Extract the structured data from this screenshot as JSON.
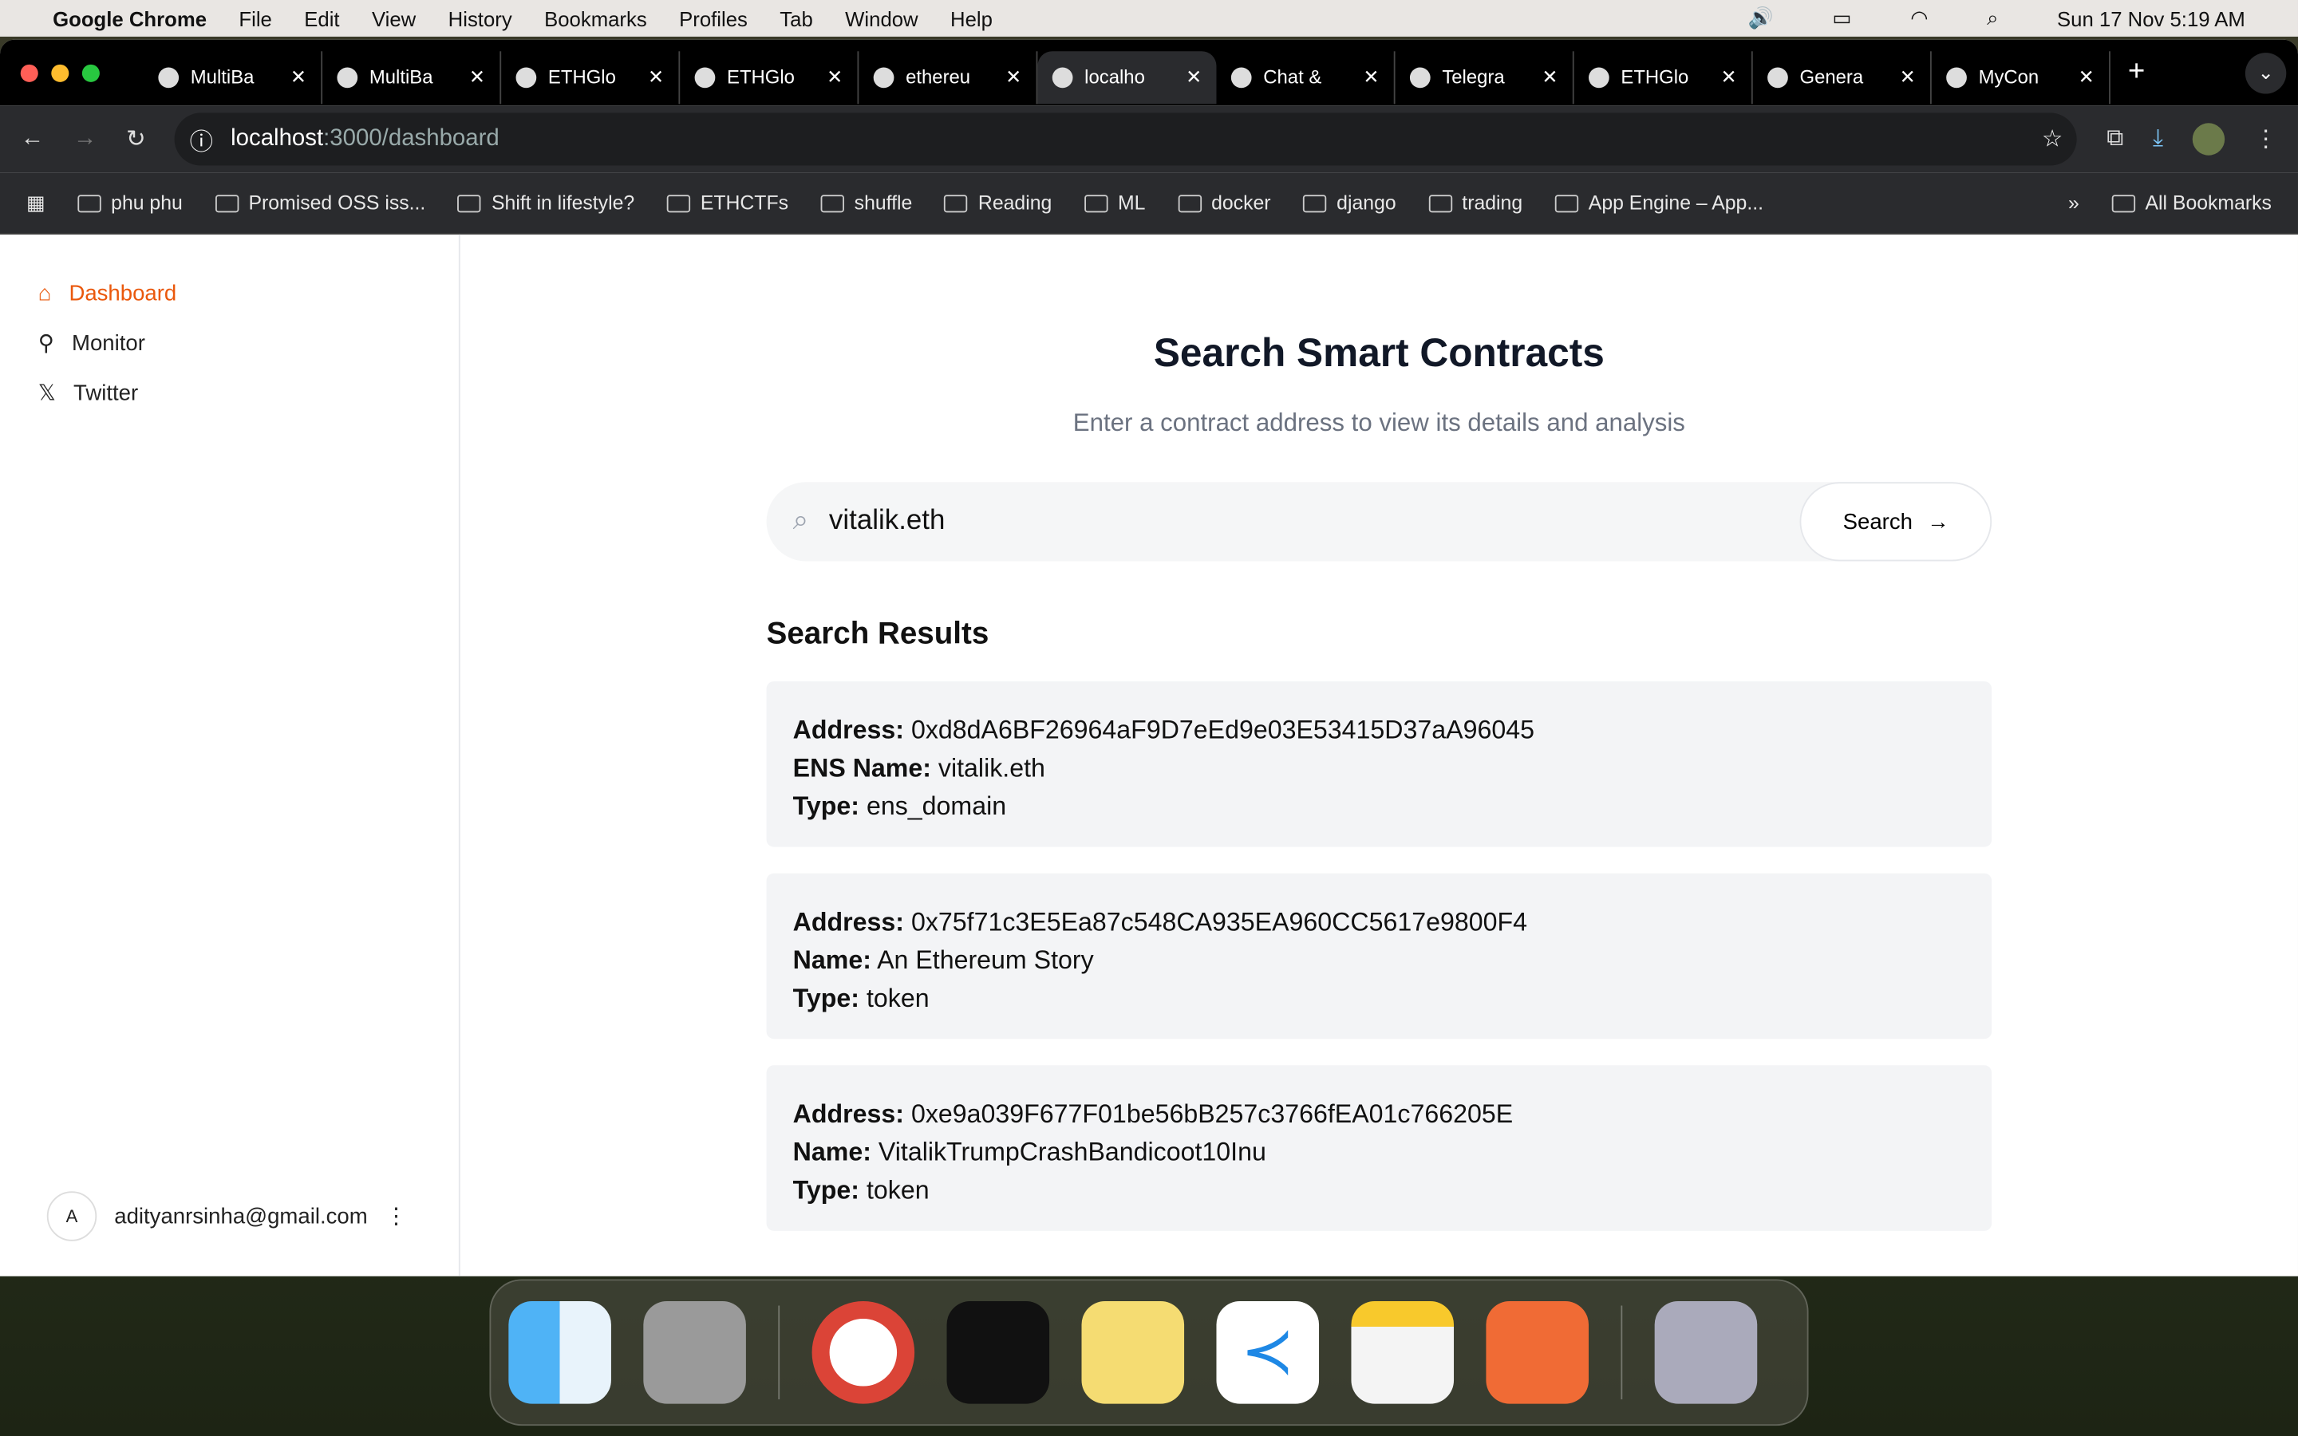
{
  "menubar": {
    "app": "Google Chrome",
    "items": [
      "File",
      "Edit",
      "View",
      "History",
      "Bookmarks",
      "Profiles",
      "Tab",
      "Window",
      "Help"
    ],
    "clock": "Sun 17 Nov  5:19 AM"
  },
  "tabs": [
    {
      "label": "MultiBa"
    },
    {
      "label": "MultiBa"
    },
    {
      "label": "ETHGlo"
    },
    {
      "label": "ETHGlo"
    },
    {
      "label": "ethereu"
    },
    {
      "label": "localho",
      "active": true
    },
    {
      "label": "Chat &"
    },
    {
      "label": "Telegra"
    },
    {
      "label": "ETHGlo"
    },
    {
      "label": "Genera"
    },
    {
      "label": "MyCon"
    }
  ],
  "address": {
    "host": "localhost",
    "path": ":3000/dashboard"
  },
  "bookmarks": [
    "phu phu",
    "Promised OSS iss...",
    "Shift in lifestyle?",
    "ETHCTFs",
    "shuffle",
    "Reading",
    "ML",
    "docker",
    "django",
    "trading",
    "App Engine – App..."
  ],
  "all_bookmarks": "All Bookmarks",
  "sidebar": {
    "items": [
      {
        "label": "Dashboard",
        "icon": "home-icon"
      },
      {
        "label": "Monitor",
        "icon": "monitor-icon"
      },
      {
        "label": "Twitter",
        "icon": "x-logo-icon"
      }
    ],
    "user_initial": "A",
    "user_email": "adityanrsinha@gmail.com"
  },
  "main": {
    "title": "Search Smart Contracts",
    "subtitle": "Enter a contract address to view its details and analysis",
    "search_value": "vitalik.eth",
    "search_button": "Search",
    "results_title": "Search Results",
    "results": [
      {
        "k1": "Address:",
        "v1": "0xd8dA6BF26964aF9D7eEd9e03E53415D37aA96045",
        "k2": "ENS Name:",
        "v2": "vitalik.eth",
        "k3": "Type:",
        "v3": "ens_domain"
      },
      {
        "k1": "Address:",
        "v1": "0x75f71c3E5Ea87c548CA935EA960CC5617e9800F4",
        "k2": "Name:",
        "v2": "An Ethereum Story",
        "k3": "Type:",
        "v3": "token"
      },
      {
        "k1": "Address:",
        "v1": "0xe9a039F677F01be56bB257c3766fEA01c766205E",
        "k2": "Name:",
        "v2": "VitalikTrumpCrashBandicoot10Inu",
        "k3": "Type:",
        "v3": "token"
      }
    ]
  },
  "colors": {
    "accent": "#ea580c"
  }
}
